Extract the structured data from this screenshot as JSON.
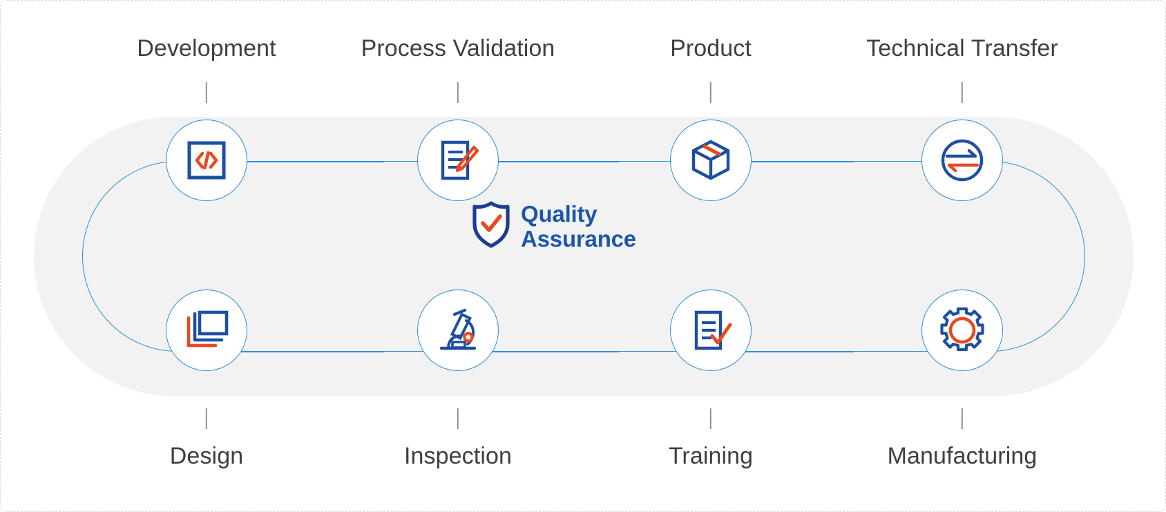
{
  "diagram": {
    "title": "Quality Assurance lifecycle wheel",
    "center": {
      "icon": "shield-check-icon",
      "line1": "Quality",
      "line2": "Assurance"
    },
    "colors": {
      "brand_blue": "#1d56ac",
      "accent_orange": "#e8491f",
      "outline_blue": "#2a8fd4",
      "label_gray": "#3f3f42",
      "backdrop_gray": "#f2f2f2"
    },
    "top_nodes": [
      {
        "label": "Development",
        "icon": "code-brackets-icon"
      },
      {
        "label": "Process Validation",
        "icon": "document-pencil-icon"
      },
      {
        "label": "Product",
        "icon": "package-box-icon"
      },
      {
        "label": "Technical Transfer",
        "icon": "transfer-arrows-icon"
      }
    ],
    "bottom_nodes": [
      {
        "label": "Design",
        "icon": "stacked-screens-icon"
      },
      {
        "label": "Inspection",
        "icon": "microscope-icon"
      },
      {
        "label": "Training",
        "icon": "checklist-check-icon"
      },
      {
        "label": "Manufacturing",
        "icon": "gear-icon"
      }
    ]
  }
}
